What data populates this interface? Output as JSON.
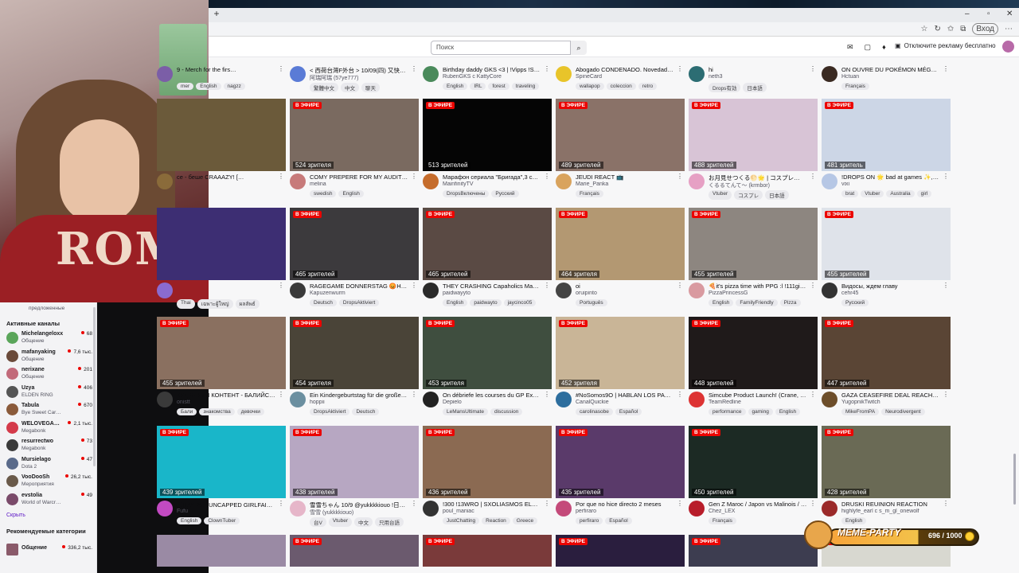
{
  "browser": {
    "new_tab": "+",
    "window_min": "–",
    "window_max": "▫",
    "window_close": "✕",
    "profile_label": "Вход"
  },
  "twitch_nav": {
    "search_placeholder": "Поиск",
    "remove_ads": "Отключите рекламу бесплатно"
  },
  "top_row": [
    {
      "title": "9 - Merch for the firs…",
      "name": "",
      "tags": [
        "mer",
        "English",
        "nagzz"
      ],
      "color": "#7b5ea7"
    },
    {
      "title": "< 西荷台灣F外台 > 10/09(四) 又快速…",
      "name": "阿瑞阿瑞 (57ye777)",
      "tags": [
        "繁體中文",
        "中文",
        "聊天"
      ],
      "color": "#5a7bd6"
    },
    {
      "title": "Birthday daddy GKS <3 | !Vipps !Sa…",
      "name": "RubenGKS с KattyCore",
      "tags": [
        "English",
        "IRL",
        "forest",
        "traveling"
      ],
      "color": "#4a8a5b"
    },
    {
      "title": "Abogado CONDENADO. Novedades…",
      "name": "SpineCard",
      "tags": [
        "wallapop",
        "coleccion",
        "retro"
      ],
      "color": "#e8c42a"
    },
    {
      "title": "hi",
      "name": "neth3",
      "tags": [
        "Drops有効",
        "日本語"
      ],
      "color": "#2c6d73"
    },
    {
      "title": "ON OUVRE DU POKÉMON MÉGA…",
      "name": "Hctuan",
      "tags": [
        "Français"
      ],
      "color": "#3a2a22"
    }
  ],
  "row1": [
    {
      "title": "ce - беше CRAAAZY! […",
      "name": "",
      "tags": [],
      "viewers": "",
      "color": "#8a6b3a",
      "thumb": "#6b5a3a"
    },
    {
      "title": "COMY PREPERE FOR MY AUDITION …",
      "name": "melina",
      "tags": [
        "swedish",
        "English"
      ],
      "viewers": "524 зрителя",
      "color": "#c77a7a",
      "thumb": "#7a6a60"
    },
    {
      "title": "Марафон сериала \"Бригада\",3 сер…",
      "name": "MainfinityTV",
      "tags": [
        "DropsВключены",
        "Русский"
      ],
      "viewers": "513 зрителей",
      "color": "#c56c2c",
      "thumb": "#050505"
    },
    {
      "title": "JEUDI REACT 📺",
      "name": "Marie_Panka",
      "tags": [
        "Français"
      ],
      "viewers": "489 зрителей",
      "color": "#d9a35d",
      "thumb": "#8a7268"
    },
    {
      "title": "お月見せつくる🌕🌟 | コスプレ…",
      "name": "くるるてんて～ (krmbor)",
      "tags": [
        "Vtuber",
        "コスプレ",
        "日本語"
      ],
      "color": "#e6a0c4",
      "viewers": "488 зрителей",
      "thumb": "#d8c4d6"
    },
    {
      "title": "!DROPS ON 🌟 bad at games ✨, …",
      "name": "vixi",
      "tags": [
        "brat",
        "Vtuber",
        "Australia",
        "girl"
      ],
      "viewers": "481 зритель",
      "color": "#b6c7e5",
      "thumb": "#ccd6e6"
    }
  ],
  "row2": [
    {
      "title": "",
      "name": "",
      "tags": [
        "Thai",
        "เฉพาะผู้ใหญ่",
        "ผลลัพธ์"
      ],
      "viewers": "",
      "color": "#8a6bd0",
      "thumb": "#3d2e73"
    },
    {
      "title": "RAGEGAME DONNERSTAG 😡Heut…",
      "name": "Kapuzenwurm",
      "tags": [
        "Deutsch",
        "DropsAktiviert"
      ],
      "viewers": "465 зрителей",
      "color": "#3a3a3a",
      "thumb": "#3c3a3d"
    },
    {
      "title": "THEY CRASHING Capaholics Mansi…",
      "name": "paidwayyto",
      "tags": [
        "English",
        "paidwayto",
        "jaycinco05"
      ],
      "viewers": "465 зрителей",
      "color": "#2a2a2a",
      "thumb": "#5a4a44"
    },
    {
      "title": "oi",
      "name": "oruipinto",
      "tags": [
        "Português"
      ],
      "viewers": "464 зрителя",
      "color": "#444",
      "thumb": "#b39872"
    },
    {
      "title": "🍕it's pizza time with PPG :l !111giv…",
      "name": "PizzaPrincessG",
      "tags": [
        "English",
        "FamilyFriendly",
        "Pizza"
      ],
      "viewers": "455 зрителей",
      "color": "#d99aa0",
      "thumb": "#8d8680"
    },
    {
      "title": "Видосы, ждем главу",
      "name": "cehr45",
      "tags": [
        "Русский"
      ],
      "viewers": "455 зрителей",
      "color": "#333",
      "thumb": "#dfe3ea"
    }
  ],
  "row3": [
    {
      "title": "КУДРЯВЫЙ КОНТЕНТ - БАЛИЙСК…",
      "name": "onistt",
      "tags": [
        "Бали",
        "знакомства",
        "девочки"
      ],
      "viewers": "455 зрителей",
      "color": "#3a3a3a",
      "thumb": "#8a7060"
    },
    {
      "title": "Ein Kindergeburtstag für die große…",
      "name": "hoppii",
      "tags": [
        "DropsAktiviert",
        "Deutsch"
      ],
      "viewers": "454 зрителя",
      "color": "#6b8fa0",
      "thumb": "#4a4438"
    },
    {
      "title": "On débriefe les courses du GP Expl…",
      "name": "Depielo",
      "tags": [
        "LeMansUltimate",
        "discussion"
      ],
      "viewers": "453 зрителя",
      "color": "#222",
      "thumb": "#3f4e3f"
    },
    {
      "title": "#NoSomos9O | HABLAN LOS PADR…",
      "name": "CanalQuickie",
      "tags": [
        "carolinasobe",
        "Español"
      ],
      "viewers": "452 зрителя",
      "color": "#2d6e9e",
      "thumb": "#c9b597"
    },
    {
      "title": "Simcube Product Launch! (Crane, …",
      "name": "TeamRedline",
      "tags": [
        "performance",
        "gaming",
        "English"
      ],
      "viewers": "448 зрителей",
      "color": "#d33",
      "thumb": "#1f1a1a"
    },
    {
      "title": "GAZA CEASEFIRE DEAL REACHE…",
      "name": "YugopnikTwitch",
      "tags": [
        "MikeFromPA",
        "Neurodivergent"
      ],
      "viewers": "447 зрителей",
      "color": "#6d4e2a",
      "thumb": "#5a4535"
    }
  ],
  "row4": [
    {
      "title": "【DAY 25】UNCAPPED GIRLFAILUR…",
      "name": "Fufu",
      "tags": [
        "English",
        "ClownTuber"
      ],
      "viewers": "439 зрителей",
      "color": "#c24ac2",
      "thumb": "#19b6c9"
    },
    {
      "title": "雪雪ちゃん 10/9 @yukkkkiouo !日主…",
      "name": "雪雪 (yukkkkiouo)",
      "tags": [
        "台V",
        "Vtuber",
        "中文",
        "只用台語"
      ],
      "viewers": "438 зрителей",
      "color": "#e6b6c9",
      "thumb": "#b7a7c2"
    },
    {
      "title": "!300 !13WRO | SXOLIASMOS EL…",
      "name": "poul_maniac",
      "tags": [
        "JustChatting",
        "Reaction",
        "Greece"
      ],
      "viewers": "436 зрителей",
      "color": "#333",
      "thumb": "#8b6a52"
    },
    {
      "title": "Por que no hice directo 2 meses",
      "name": "perfiraro",
      "tags": [
        "perfiraro",
        "Español"
      ],
      "viewers": "435 зрителей",
      "color": "#c44a7a",
      "thumb": "#5a3a6a"
    },
    {
      "title": "Gen Z Maroc / Japon vs Malinois / it…",
      "name": "Chez_LEX",
      "tags": [
        "Français"
      ],
      "viewers": "450 зрителей",
      "color": "#b81d2a",
      "thumb": "#1c2a24"
    },
    {
      "title": "DRUSKI REUINION REACTION",
      "name": "highlyfe_earl с s_m_gl_onewolf",
      "tags": [
        "English"
      ],
      "viewers": "428 зрителей",
      "color": "#9b2a2a",
      "thumb": "#6a6a55"
    }
  ],
  "row5_thumbs": [
    "#9a8aa4",
    "#6b5a6e",
    "#7a3a3a",
    "#2a1e3e",
    "#3d3d50",
    "#d8d8d0"
  ],
  "live_label": "В ЭФИРЕ",
  "sidebar": {
    "suggest": "предложенные",
    "active_header": "Активные каналы",
    "channels": [
      {
        "name": "Michelangeloxx",
        "game": "Общение",
        "viewers": "68",
        "color": "#5aa55a"
      },
      {
        "name": "mafanyaking",
        "game": "Общение",
        "viewers": "7,6 тыс.",
        "color": "#6a4a3a"
      },
      {
        "name": "nerixane",
        "game": "Общение",
        "viewers": "201",
        "color": "#c26a7a"
      },
      {
        "name": "Uzya",
        "game": "ELDEN RING",
        "viewers": "406",
        "color": "#555"
      },
      {
        "name": "Tabula",
        "game": "Bye Sweet Car…",
        "viewers": "670",
        "color": "#8a5a3a"
      },
      {
        "name": "WELOVEGA…",
        "game": "Megabonk",
        "viewers": "2,1 тыс.",
        "color": "#d43a4a"
      },
      {
        "name": "resurrectwo",
        "game": "Megabonk",
        "viewers": "73",
        "color": "#3a3a3a"
      },
      {
        "name": "Mursielago",
        "game": "Dota 2",
        "viewers": "47",
        "color": "#5a6a8a"
      },
      {
        "name": "VooDooSh",
        "game": "Мероприятия",
        "viewers": "26,2 тыс.",
        "color": "#6a5a4a"
      },
      {
        "name": "evstolia",
        "game": "World of Warcr…",
        "viewers": "49",
        "color": "#7a4a6a"
      }
    ],
    "hide": "Скрыть",
    "recommended_header": "Рекомендуемые категории",
    "category": {
      "name": "Общение",
      "viewers": "336,2 тыс."
    }
  },
  "meme_widget": {
    "title": "MEME-PARTY",
    "count": "696 / 1000"
  },
  "webcam": {
    "shirt_text": "ROMA"
  }
}
